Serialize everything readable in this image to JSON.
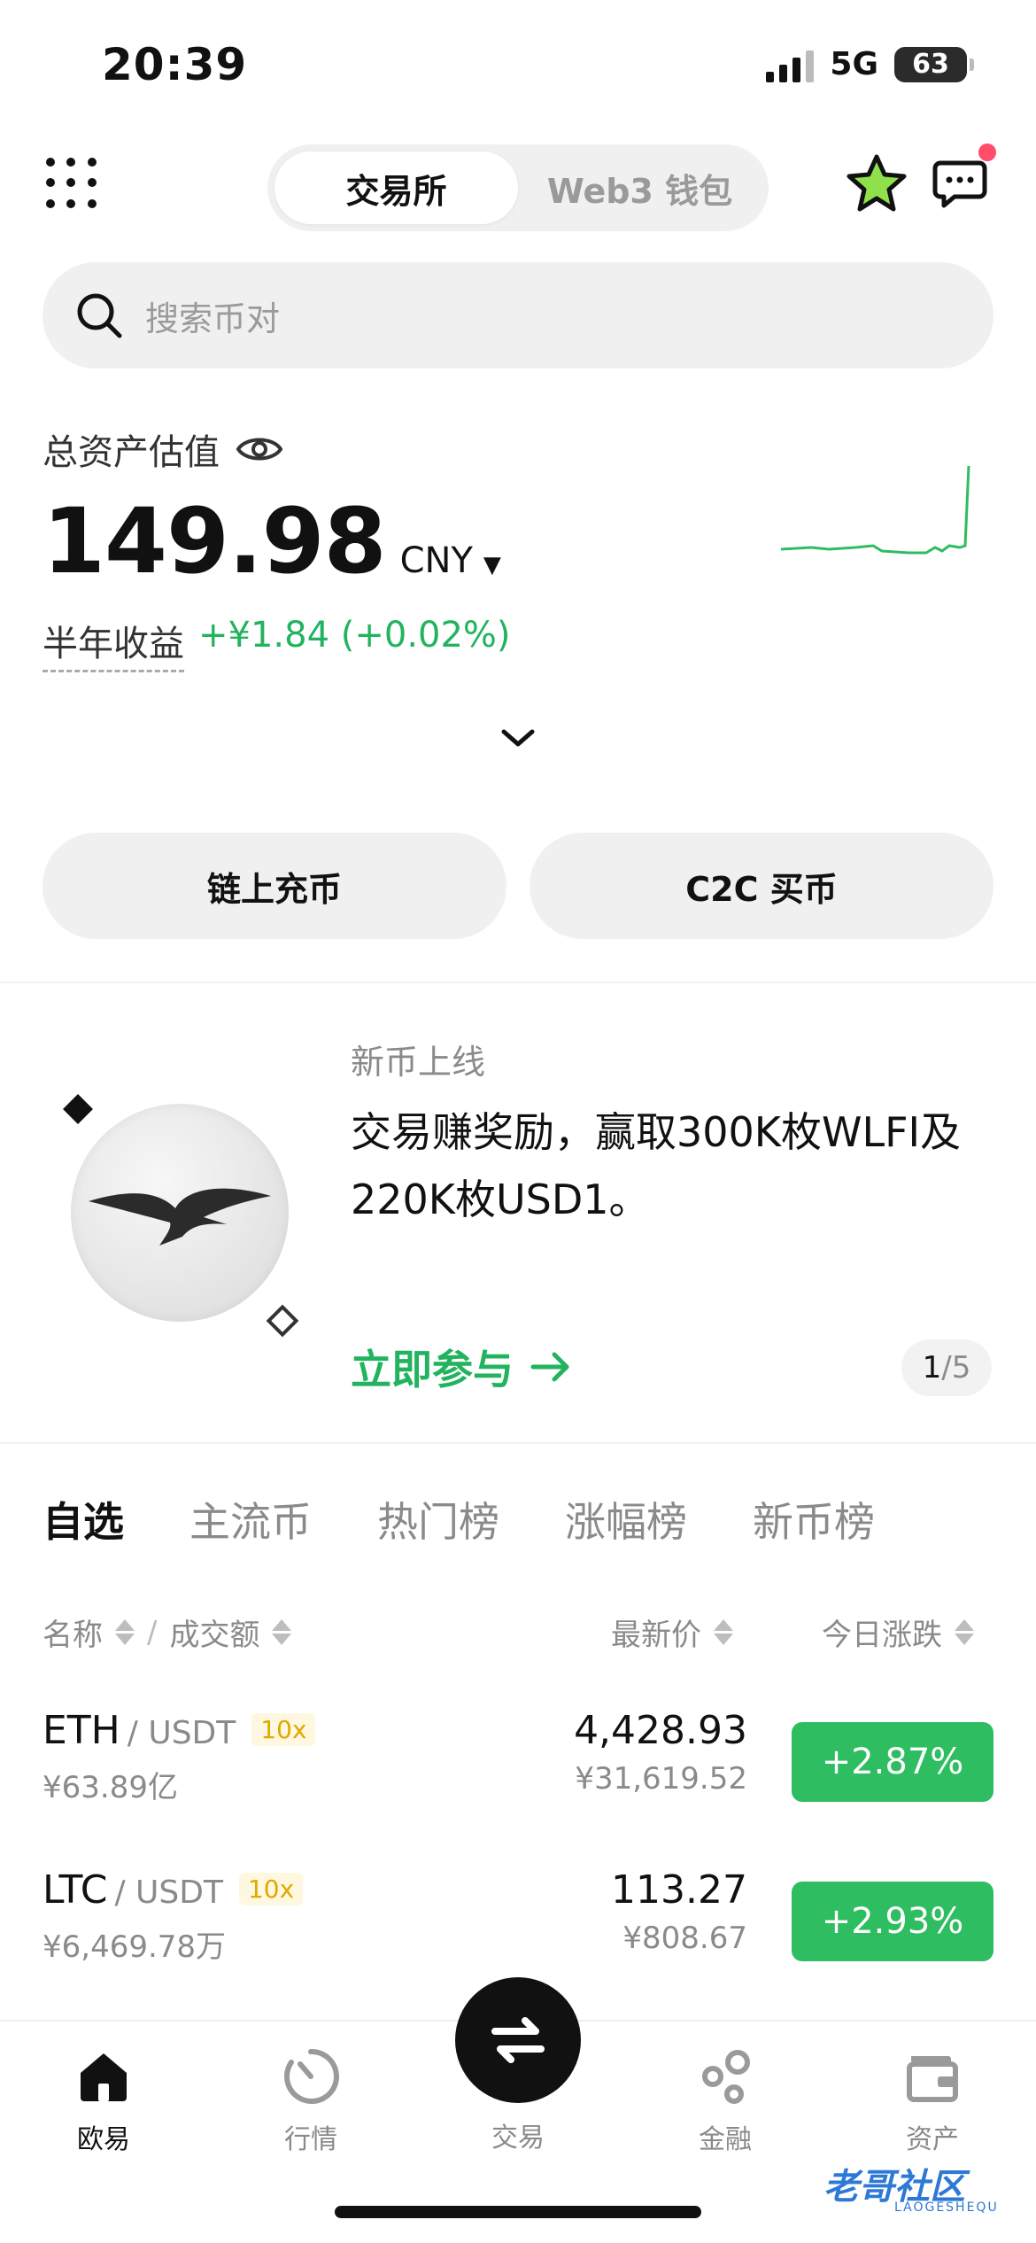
{
  "status_bar": {
    "time": "20:39",
    "network": "5G",
    "battery": "63"
  },
  "header": {
    "tabs": [
      {
        "label": "交易所",
        "active": true
      },
      {
        "label": "Web3 钱包",
        "active": false
      }
    ],
    "favorite_icon": "star-icon",
    "message_icon": "chat-bubble-icon"
  },
  "search": {
    "placeholder": "搜索币对"
  },
  "assets": {
    "label": "总资产估值",
    "value": "149.98",
    "currency": "CNY",
    "pnl_label": "半年收益",
    "pnl_value": "+¥1.84 (+0.02%)"
  },
  "actions": {
    "deposit": "链上充币",
    "c2c": "C2C 买币"
  },
  "banner": {
    "tag": "新币上线",
    "title": "交易赚奖励，赢取300K枚WLFI及220K枚USD1。",
    "cta": "立即参与",
    "page_current": "1",
    "page_total": "/5"
  },
  "market": {
    "tabs": [
      "自选",
      "主流币",
      "热门榜",
      "涨幅榜",
      "新币榜"
    ],
    "active_tab": "自选",
    "columns": {
      "name": "名称",
      "sep": "/",
      "volume": "成交额",
      "price": "最新价",
      "change": "今日涨跌"
    },
    "rows": [
      {
        "base": "ETH",
        "quote": "/ USDT",
        "leverage": "10x",
        "volume": "¥63.89亿",
        "price": "4,428.93",
        "price_cny": "¥31,619.52",
        "change": "+2.87%"
      },
      {
        "base": "LTC",
        "quote": "/ USDT",
        "leverage": "10x",
        "volume": "¥6,469.78万",
        "price": "113.27",
        "price_cny": "¥808.67",
        "change": "+2.93%"
      }
    ]
  },
  "nav": {
    "items": [
      {
        "label": "欧易",
        "icon": "home-icon",
        "active": true
      },
      {
        "label": "行情",
        "icon": "market-clock-icon",
        "active": false
      },
      {
        "label": "交易",
        "icon": "swap-icon",
        "active": false
      },
      {
        "label": "金融",
        "icon": "finance-nodes-icon",
        "active": false
      },
      {
        "label": "资产",
        "icon": "wallet-icon",
        "active": false
      }
    ]
  },
  "watermark": {
    "text": "老哥社区",
    "sub": "LAOGESHEQU"
  },
  "colors": {
    "green": "#2ebd60",
    "accent_green_text": "#22b35f",
    "badge_red": "#ff4d6a",
    "leverage": "#e0a800"
  }
}
